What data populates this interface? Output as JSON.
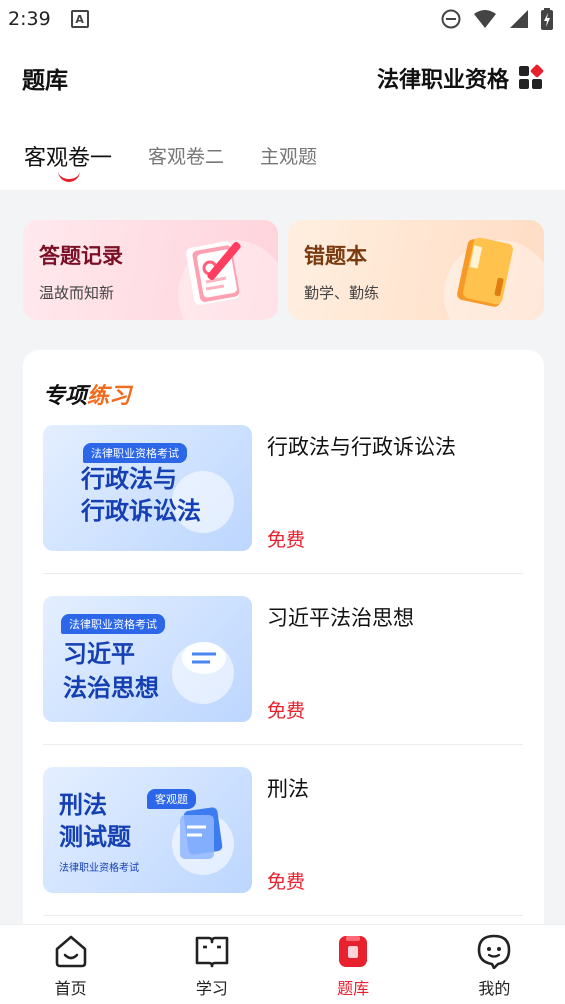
{
  "status": {
    "time": "2:39",
    "notification_icon": "A"
  },
  "header": {
    "title": "题库",
    "exam": "法律职业资格"
  },
  "tabs": [
    {
      "label": "客观卷一",
      "active": true
    },
    {
      "label": "客观卷二",
      "active": false
    },
    {
      "label": "主观题",
      "active": false
    }
  ],
  "cards": {
    "record": {
      "title": "答题记录",
      "subtitle": "温故而知新"
    },
    "wrong": {
      "title": "错题本",
      "subtitle": "勤学、勤练"
    }
  },
  "practice": {
    "title_a": "专项",
    "title_b": "练习",
    "items": [
      {
        "name": "行政法与行政诉讼法",
        "price": "免费",
        "thumb_badge": "法律职业资格考试",
        "thumb_line1": "行政法与",
        "thumb_line2": "行政诉讼法"
      },
      {
        "name": "习近平法治思想",
        "price": "免费",
        "thumb_badge": "法律职业资格考试",
        "thumb_line1": "习近平",
        "thumb_line2": "法治思想"
      },
      {
        "name": "刑法",
        "price": "免费",
        "thumb_badge": "客观题",
        "thumb_line1": "刑法",
        "thumb_line2": "测试题",
        "thumb_small": "法律职业资格考试"
      }
    ]
  },
  "nav": [
    {
      "label": "首页",
      "icon": "home-icon",
      "active": false
    },
    {
      "label": "学习",
      "icon": "book-icon",
      "active": false
    },
    {
      "label": "题库",
      "icon": "question-bank-icon",
      "active": true
    },
    {
      "label": "我的",
      "icon": "profile-icon",
      "active": false
    }
  ],
  "colors": {
    "accent": "#e8212f",
    "orange": "#f26a1b",
    "thumb_blue": "#1540b3"
  }
}
